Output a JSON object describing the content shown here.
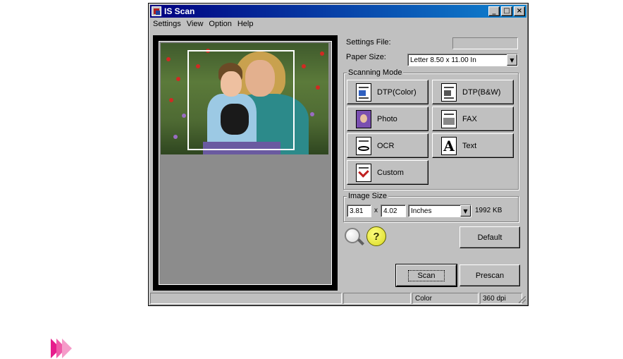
{
  "window": {
    "title": "IS Scan",
    "controls": [
      "_",
      "□",
      "×"
    ]
  },
  "menu": [
    {
      "label": "Settings"
    },
    {
      "label": "View"
    },
    {
      "label": "Option"
    },
    {
      "label": "Help"
    }
  ],
  "settings_file": {
    "label": "Settings File:",
    "value": ""
  },
  "paper_size": {
    "label": "Paper Size:",
    "value": "Letter 8.50 x 11.00 In"
  },
  "scanning_mode": {
    "title": "Scanning Mode",
    "buttons": [
      {
        "label": "DTP(Color)",
        "icon": "dtp-color-icon"
      },
      {
        "label": "DTP(B&W)",
        "icon": "dtp-bw-icon"
      },
      {
        "label": "Photo",
        "icon": "photo-icon"
      },
      {
        "label": "FAX",
        "icon": "fax-icon"
      },
      {
        "label": "OCR",
        "icon": "ocr-icon"
      },
      {
        "label": "Text",
        "icon": "text-icon"
      },
      {
        "label": "Custom",
        "icon": "custom-icon"
      }
    ]
  },
  "image_size": {
    "title": "Image Size",
    "width": "3.81",
    "times": "x",
    "height": "4.02",
    "unit": "Inches",
    "filesize": "1992 KB"
  },
  "buttons": {
    "default": "Default",
    "scan": "Scan",
    "prescan": "Prescan"
  },
  "help_icon_glyph": "?",
  "status": {
    "cell1": "",
    "cell2": "",
    "color": "Color",
    "dpi": "360 dpi"
  }
}
